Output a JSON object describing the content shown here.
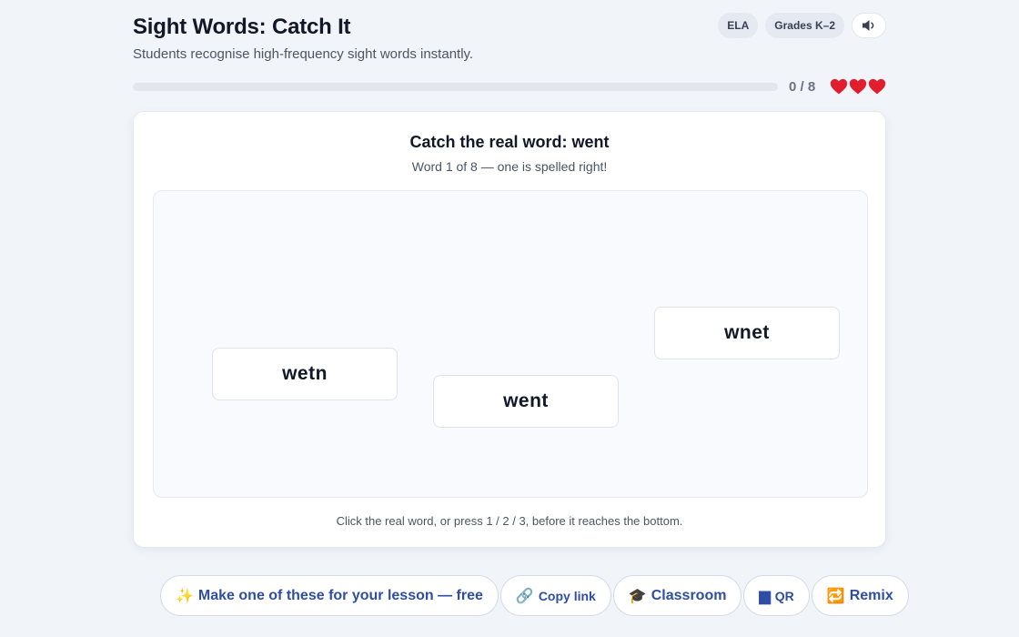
{
  "header": {
    "title": "Sight Words: Catch It",
    "subtitle": "Students recognise high-frequency sight words instantly.",
    "badges": [
      "ELA",
      "Grades K–2"
    ],
    "sound_icon": "speaker-icon"
  },
  "progress": {
    "fraction": 0,
    "score_text": "0 / 8",
    "lives": 3,
    "heart_icon": "heart-icon",
    "colors": {
      "track": "#e2e6ee",
      "fill": "#3b82f6",
      "heart": "#e11d2e"
    }
  },
  "game": {
    "prompt_prefix": "Catch the real word:",
    "target_word": "went",
    "subprompt": "Word 1 of 8 — one is spelled right!",
    "words": [
      "wetn",
      "went",
      "wnet"
    ],
    "hint": "Click the real word, or press 1 / 2 / 3, before it reaches the bottom."
  },
  "actions": [
    {
      "icon": "✨",
      "label": "Make one of these for your lesson — free"
    },
    {
      "icon": "🔗",
      "label": "Copy link"
    },
    {
      "icon": "🎓",
      "label": "Classroom"
    },
    {
      "icon": "▆",
      "label": "QR"
    },
    {
      "icon": "🔁",
      "label": "Remix"
    }
  ]
}
